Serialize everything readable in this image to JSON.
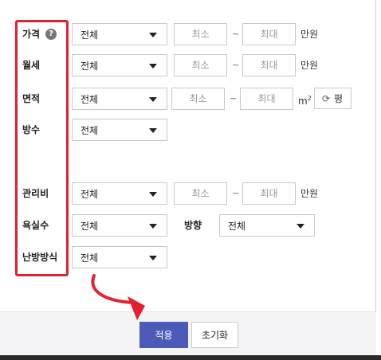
{
  "filters": {
    "price": {
      "label": "가격",
      "help": "?",
      "select": "전체",
      "min_placeholder": "최소",
      "max_placeholder": "최대",
      "tilde": "~",
      "unit": "만원"
    },
    "rent": {
      "label": "월세",
      "select": "전체",
      "min_placeholder": "최소",
      "max_placeholder": "최대",
      "tilde": "~",
      "unit": "만원"
    },
    "area": {
      "label": "면적",
      "select": "전체",
      "min_placeholder": "최소",
      "max_placeholder": "최대",
      "tilde": "~",
      "unit": "m",
      "unit_sup": "2",
      "toggle_label": "평"
    },
    "rooms": {
      "label": "방수",
      "select": "전체"
    },
    "maintenance": {
      "label": "관리비",
      "select": "전체",
      "min_placeholder": "최소",
      "max_placeholder": "최대",
      "tilde": "~",
      "unit": "만원"
    },
    "bathrooms": {
      "label": "욕실수",
      "select": "전체"
    },
    "direction": {
      "label": "방향",
      "select": "전체"
    },
    "heating": {
      "label": "난방방식",
      "select": "전체"
    }
  },
  "buttons": {
    "apply": "적용",
    "reset": "초기화"
  },
  "colors": {
    "highlight": "#e3202f",
    "primary": "#4b5bb7"
  }
}
